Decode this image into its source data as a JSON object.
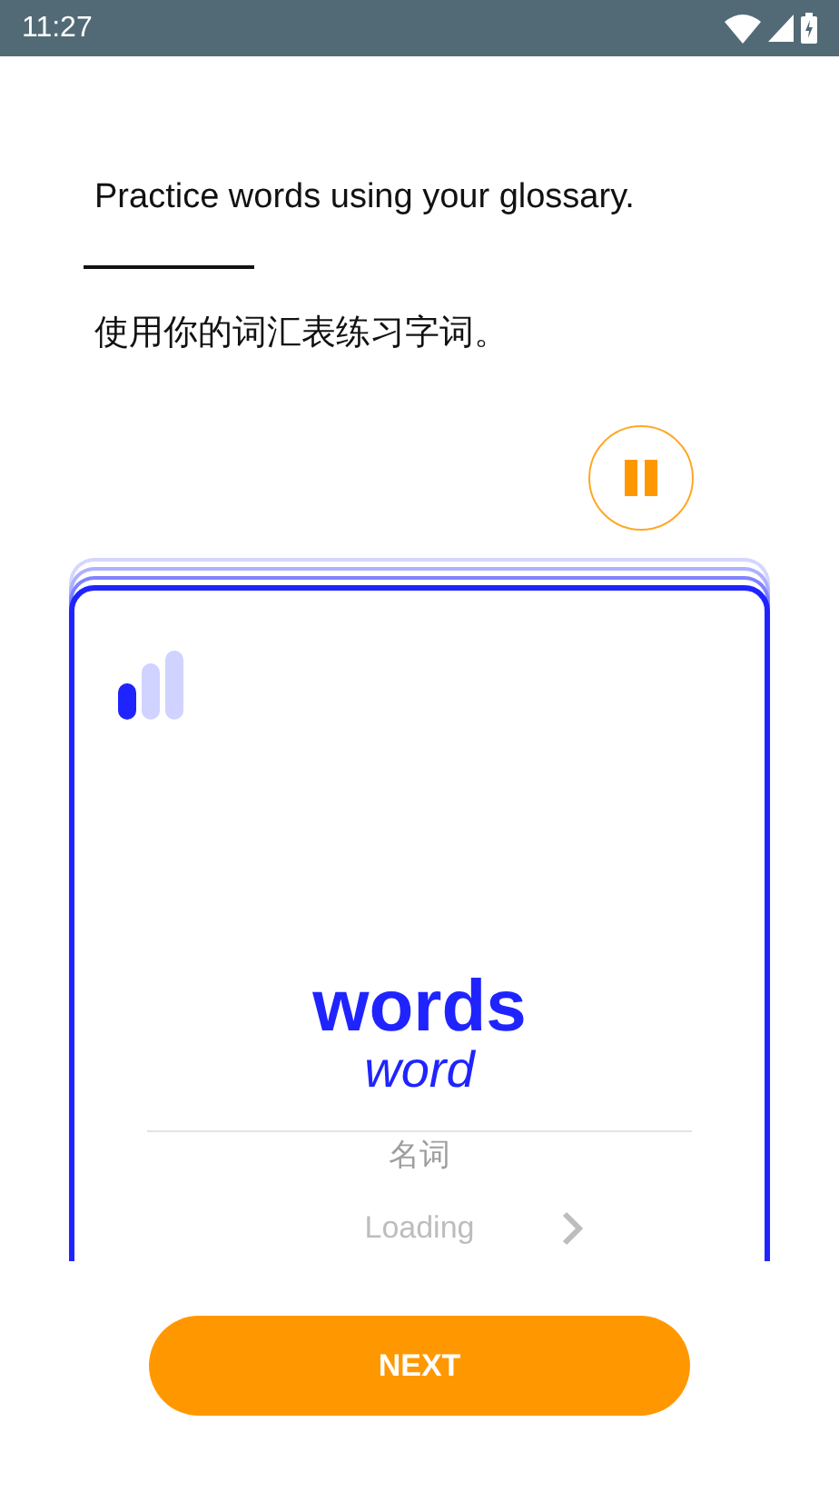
{
  "status_bar": {
    "time": "11:27"
  },
  "instruction": {
    "english": "Practice words using your glossary.",
    "chinese": "使用你的词汇表练习字词。"
  },
  "pause_button": {
    "paused": false
  },
  "card": {
    "word": "words",
    "lemma": "word",
    "part_of_speech": "名词",
    "loading": "Loading"
  },
  "next_button": {
    "label": "NEXT"
  }
}
